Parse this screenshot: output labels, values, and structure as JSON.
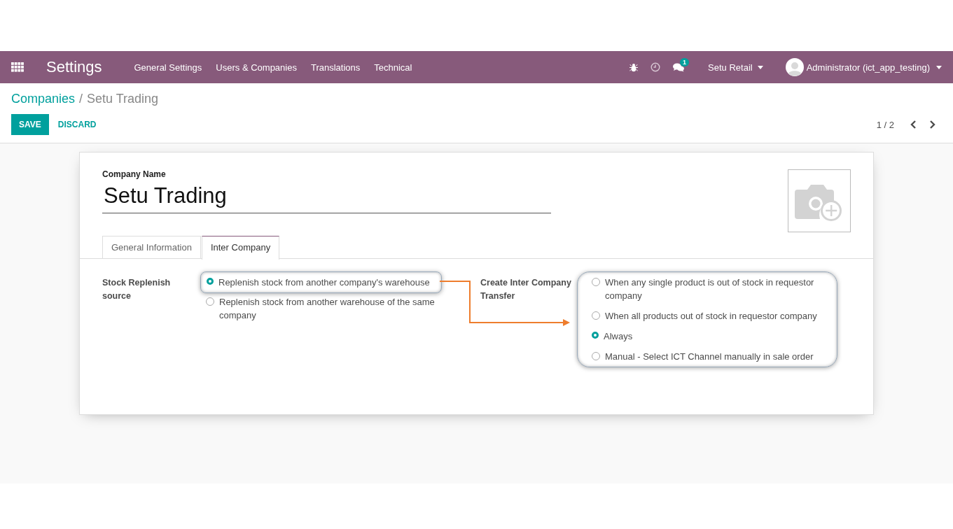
{
  "navbar": {
    "app_title": "Settings",
    "menu": [
      "General Settings",
      "Users & Companies",
      "Translations",
      "Technical"
    ],
    "chat_badge": "1",
    "company": "Setu Retail",
    "user": "Administrator (ict_app_testing)"
  },
  "breadcrumb": {
    "parent": "Companies",
    "separator": "/",
    "current": "Setu Trading"
  },
  "buttons": {
    "save": "SAVE",
    "discard": "DISCARD"
  },
  "pager": "1 / 2",
  "form": {
    "company_name_label": "Company Name",
    "company_name": "Setu Trading",
    "tabs": [
      {
        "label": "General Information",
        "selected": false
      },
      {
        "label": "Inter Company",
        "selected": true
      }
    ],
    "fields": [
      {
        "label": "Stock Replenish source",
        "options": [
          {
            "label": "Replenish stock from another company's warehouse",
            "selected": true,
            "highlighted": true
          },
          {
            "label": "Replenish stock from another warehouse of the same company",
            "selected": false,
            "highlighted": false
          }
        ]
      },
      {
        "label": "Create Inter Company Transfer",
        "options": [
          {
            "label": "When any single product is out of stock in requestor company",
            "selected": false,
            "highlighted": true
          },
          {
            "label": "When all products out of stock in requestor company",
            "selected": false,
            "highlighted": true
          },
          {
            "label": "Always",
            "selected": true,
            "highlighted": true
          },
          {
            "label": "Manual - Select ICT Channel manually in sale order",
            "selected": false,
            "highlighted": true
          }
        ]
      }
    ]
  }
}
